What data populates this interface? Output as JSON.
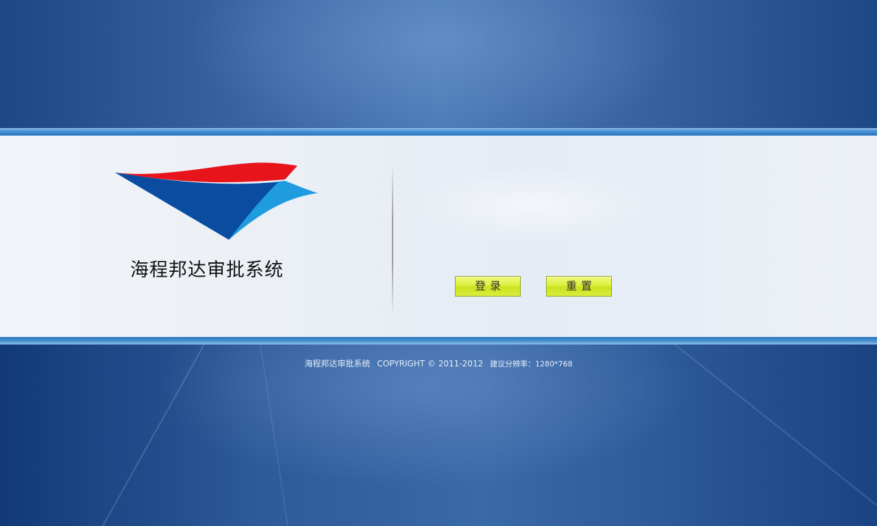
{
  "brand": {
    "system_name": "海程邦达审批系统",
    "logo_icon": "wing-logo-icon",
    "colors": {
      "logo_red": "#e8141b",
      "logo_blue": "#0a4da0",
      "logo_cyan": "#1f9be0"
    }
  },
  "form": {
    "login_label": "登录",
    "reset_label": "重置",
    "button_color": "#d6ec36"
  },
  "footer": {
    "system_name": "海程邦达审批系统",
    "copyright": "COPYRIGHT © 2011-2012",
    "resolution": "建议分辨率：1280*768"
  },
  "theme": {
    "background": "#2f5c9c",
    "band": "#eaeff6",
    "band_edge": "#4b93d2"
  }
}
